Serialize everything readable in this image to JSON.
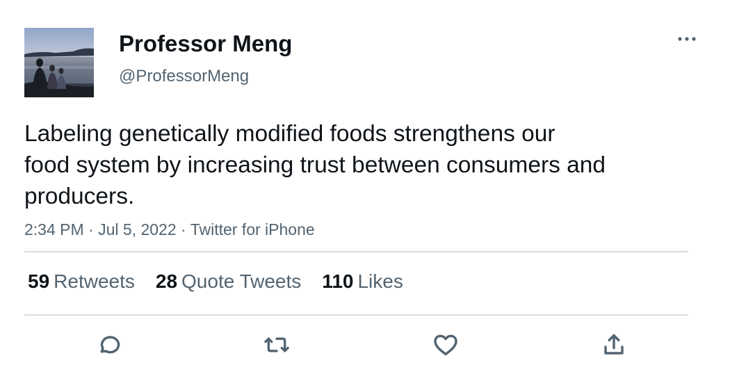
{
  "author": {
    "display_name": "Professor Meng",
    "handle": "@ProfessorMeng"
  },
  "tweet": {
    "text_lines": [
      "Labeling genetically modified foods strengthens our",
      "food system by increasing trust between consumers and",
      "producers."
    ],
    "time": "2:34 PM",
    "date": "Jul 5, 2022",
    "source": "Twitter for iPhone",
    "separator": "·"
  },
  "stats": {
    "retweets": {
      "count": "59",
      "label": "Retweets"
    },
    "quotes": {
      "count": "28",
      "label": "Quote Tweets"
    },
    "likes": {
      "count": "110",
      "label": "Likes"
    }
  },
  "icons": {
    "more": "more-horizontal-icon",
    "reply": "reply-icon",
    "retweet": "retweet-icon",
    "like": "heart-icon",
    "share": "share-icon"
  },
  "colors": {
    "text": "#0f1419",
    "secondary": "#536471",
    "divider": "#d8dde1"
  }
}
